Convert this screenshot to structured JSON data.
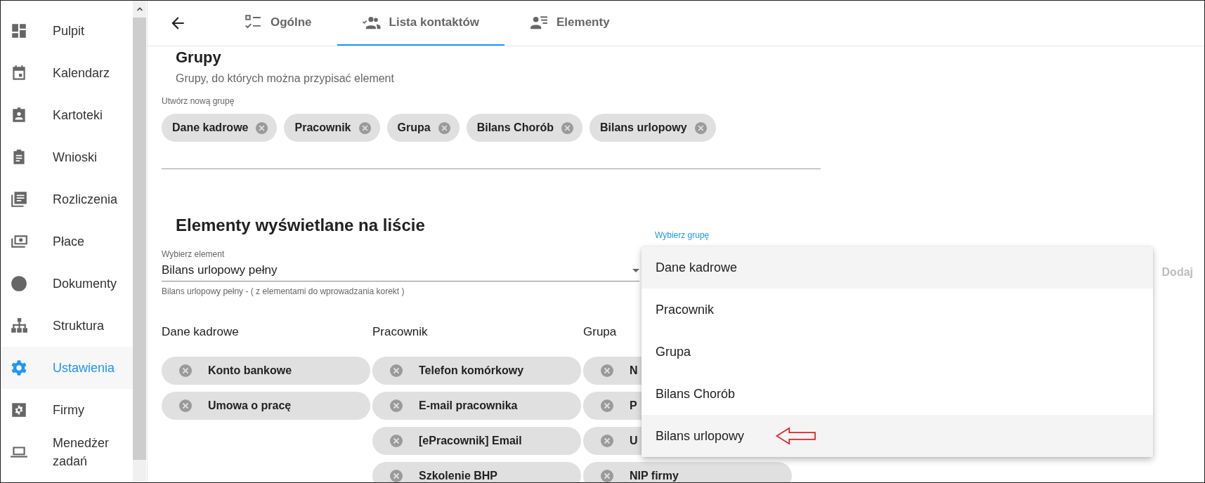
{
  "sidebar": {
    "items": [
      {
        "label": "Pulpit",
        "selected": false
      },
      {
        "label": "Kalendarz",
        "selected": false
      },
      {
        "label": "Kartoteki",
        "selected": false
      },
      {
        "label": "Wnioski",
        "selected": false
      },
      {
        "label": "Rozliczenia",
        "selected": false
      },
      {
        "label": "Płace",
        "selected": false
      },
      {
        "label": "Dokumenty",
        "selected": false
      },
      {
        "label": "Struktura",
        "selected": false
      },
      {
        "label": "Ustawienia",
        "selected": true
      },
      {
        "label": "Firmy",
        "selected": false
      },
      {
        "label": "Menedżer zadań",
        "selected": false
      }
    ]
  },
  "tabs": [
    {
      "label": "Ogólne",
      "selected": false
    },
    {
      "label": "Lista kontaktów",
      "selected": true
    },
    {
      "label": "Elementy",
      "selected": false
    }
  ],
  "groups": {
    "title": "Grupy",
    "subtitle": "Grupy, do których można przypisać element",
    "field_label": "Utwórz nową grupę",
    "chips": [
      "Dane kadrowe",
      "Pracownik",
      "Grupa",
      "Bilans Chorób",
      "Bilans urlopowy"
    ]
  },
  "elements": {
    "title": "Elementy wyświetlane na liście",
    "element_select": {
      "label": "Wybierz element",
      "value": "Bilans urlopowy pełny",
      "hint": "Bilans urlopowy pełny - ( z elementami do wprowadzania korekt )"
    },
    "group_select": {
      "label": "Wybierz grupę"
    },
    "add_button": {
      "label": "Dodaj",
      "disabled": true
    },
    "columns": [
      {
        "header": "Dane kadrowe",
        "items": [
          "Konto bankowe",
          "Umowa o pracę"
        ]
      },
      {
        "header": "Pracownik",
        "items": [
          "Telefon komórkowy",
          "E-mail pracownika",
          "[ePracownik] Email",
          "Szkolenie BHP"
        ]
      },
      {
        "header": "Grupa",
        "items": [
          "N",
          "P",
          "U",
          "NIP firmy"
        ]
      }
    ]
  },
  "group_menu": {
    "items": [
      {
        "label": "Dane kadrowe",
        "highlighted": true,
        "marked": false
      },
      {
        "label": "Pracownik",
        "highlighted": false,
        "marked": false
      },
      {
        "label": "Grupa",
        "highlighted": false,
        "marked": false
      },
      {
        "label": "Bilans Chorób",
        "highlighted": false,
        "marked": false
      },
      {
        "label": "Bilans urlopowy",
        "highlighted": true,
        "marked": true
      }
    ]
  }
}
